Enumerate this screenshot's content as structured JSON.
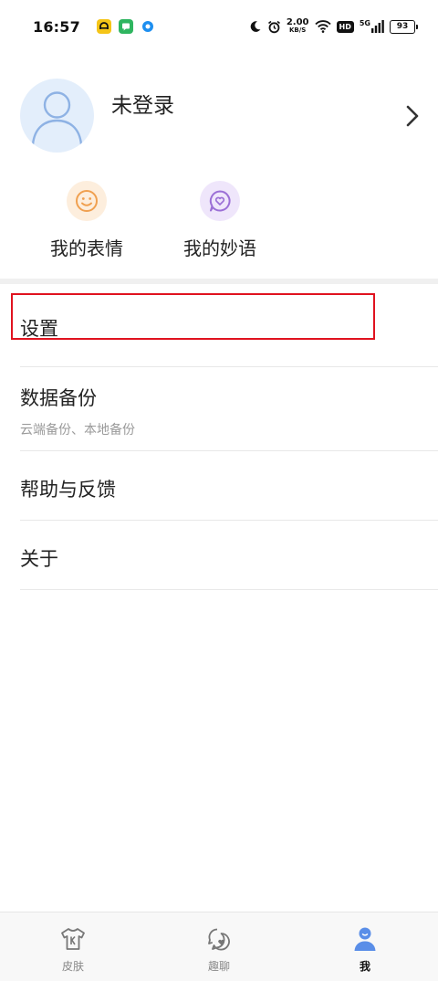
{
  "status_bar": {
    "time": "16:57",
    "net_speed_value": "2.00",
    "net_speed_unit": "KB/S",
    "hd_label": "HD",
    "network_label": "5G",
    "battery_level": "93"
  },
  "profile": {
    "login_status": "未登录"
  },
  "quick_actions": [
    {
      "label": "我的表情"
    },
    {
      "label": "我的妙语"
    }
  ],
  "menu": [
    {
      "title": "设置"
    },
    {
      "title": "数据备份",
      "subtitle": "云端备份、本地备份"
    },
    {
      "title": "帮助与反馈"
    },
    {
      "title": "关于"
    }
  ],
  "bottom_nav": [
    {
      "label": "皮肤"
    },
    {
      "label": "趣聊"
    },
    {
      "label": "我"
    }
  ],
  "colors": {
    "avatar_bg": "#e3eefb",
    "emoji_accent": "#f0a050",
    "quote_accent": "#9b6fd6",
    "nav_active": "#5a8ee8",
    "highlight": "#e0131f"
  }
}
